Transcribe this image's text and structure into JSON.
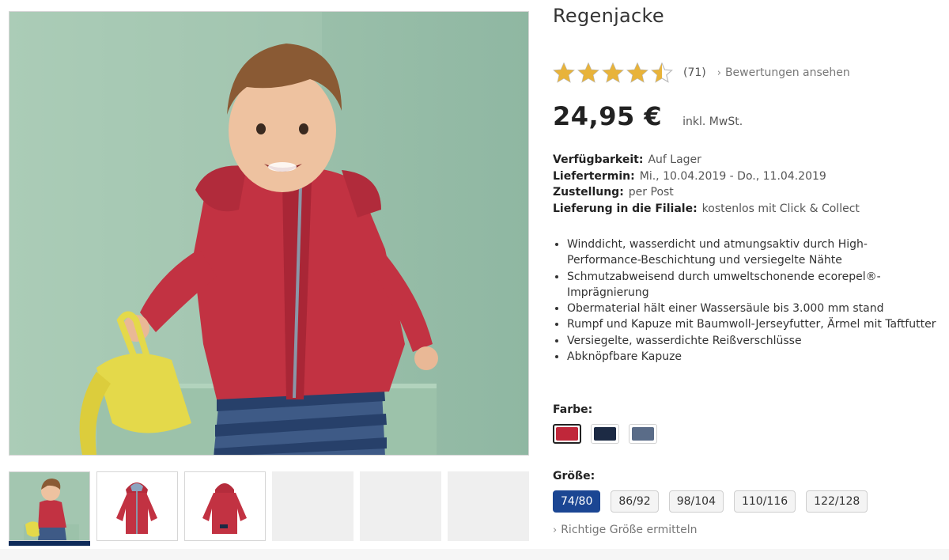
{
  "product": {
    "title": "Regenjacke",
    "rating": 4.5,
    "rating_max": 5,
    "rating_count": "(71)",
    "reviews_link": "Bewertungen ansehen",
    "price": "24,95 €",
    "vat_note": "inkl. MwSt."
  },
  "facts": [
    {
      "label": "Verfügbarkeit:",
      "value": "Auf Lager"
    },
    {
      "label": "Liefertermin:",
      "value": "Mi., 10.04.2019 - Do., 11.04.2019"
    },
    {
      "label": "Zustellung:",
      "value": "per Post"
    },
    {
      "label": "Lieferung in die Filiale:",
      "value": "kostenlos mit Click & Collect"
    }
  ],
  "features": [
    "Winddicht, wasserdicht und atmungsaktiv durch High-Performance-Beschichtung und versiegelte Nähte",
    "Schmutzabweisend durch umweltschonende ecorepel®-Imprägnierung",
    "Obermaterial hält einer Wassersäule bis 3.000 mm stand",
    "Rumpf und Kapuze mit Baumwoll-Jerseyfutter, Ärmel mit Taftfutter",
    "Versiegelte, wasserdichte Reißverschlüsse",
    "Abknöpfbare Kapuze"
  ],
  "color": {
    "label": "Farbe:",
    "options": [
      {
        "hex": "#c0273a",
        "selected": true
      },
      {
        "hex": "#1c2a44",
        "selected": false
      },
      {
        "hex": "#5a6c88",
        "selected": false
      }
    ]
  },
  "size": {
    "label": "Größe:",
    "options": [
      "74/80",
      "86/92",
      "98/104",
      "110/116",
      "122/128"
    ],
    "selected": "74/80",
    "guide_link": "Richtige Größe ermitteln"
  },
  "gallery": {
    "thumbnails": [
      "child-wearing-jacket",
      "jacket-front",
      "jacket-back",
      "empty",
      "empty",
      "empty"
    ],
    "active_index": 0
  },
  "colors": {
    "star": "#e8b33a",
    "accent_blue": "#1b4693",
    "thumb_active_bar": "#0f2b5a"
  }
}
